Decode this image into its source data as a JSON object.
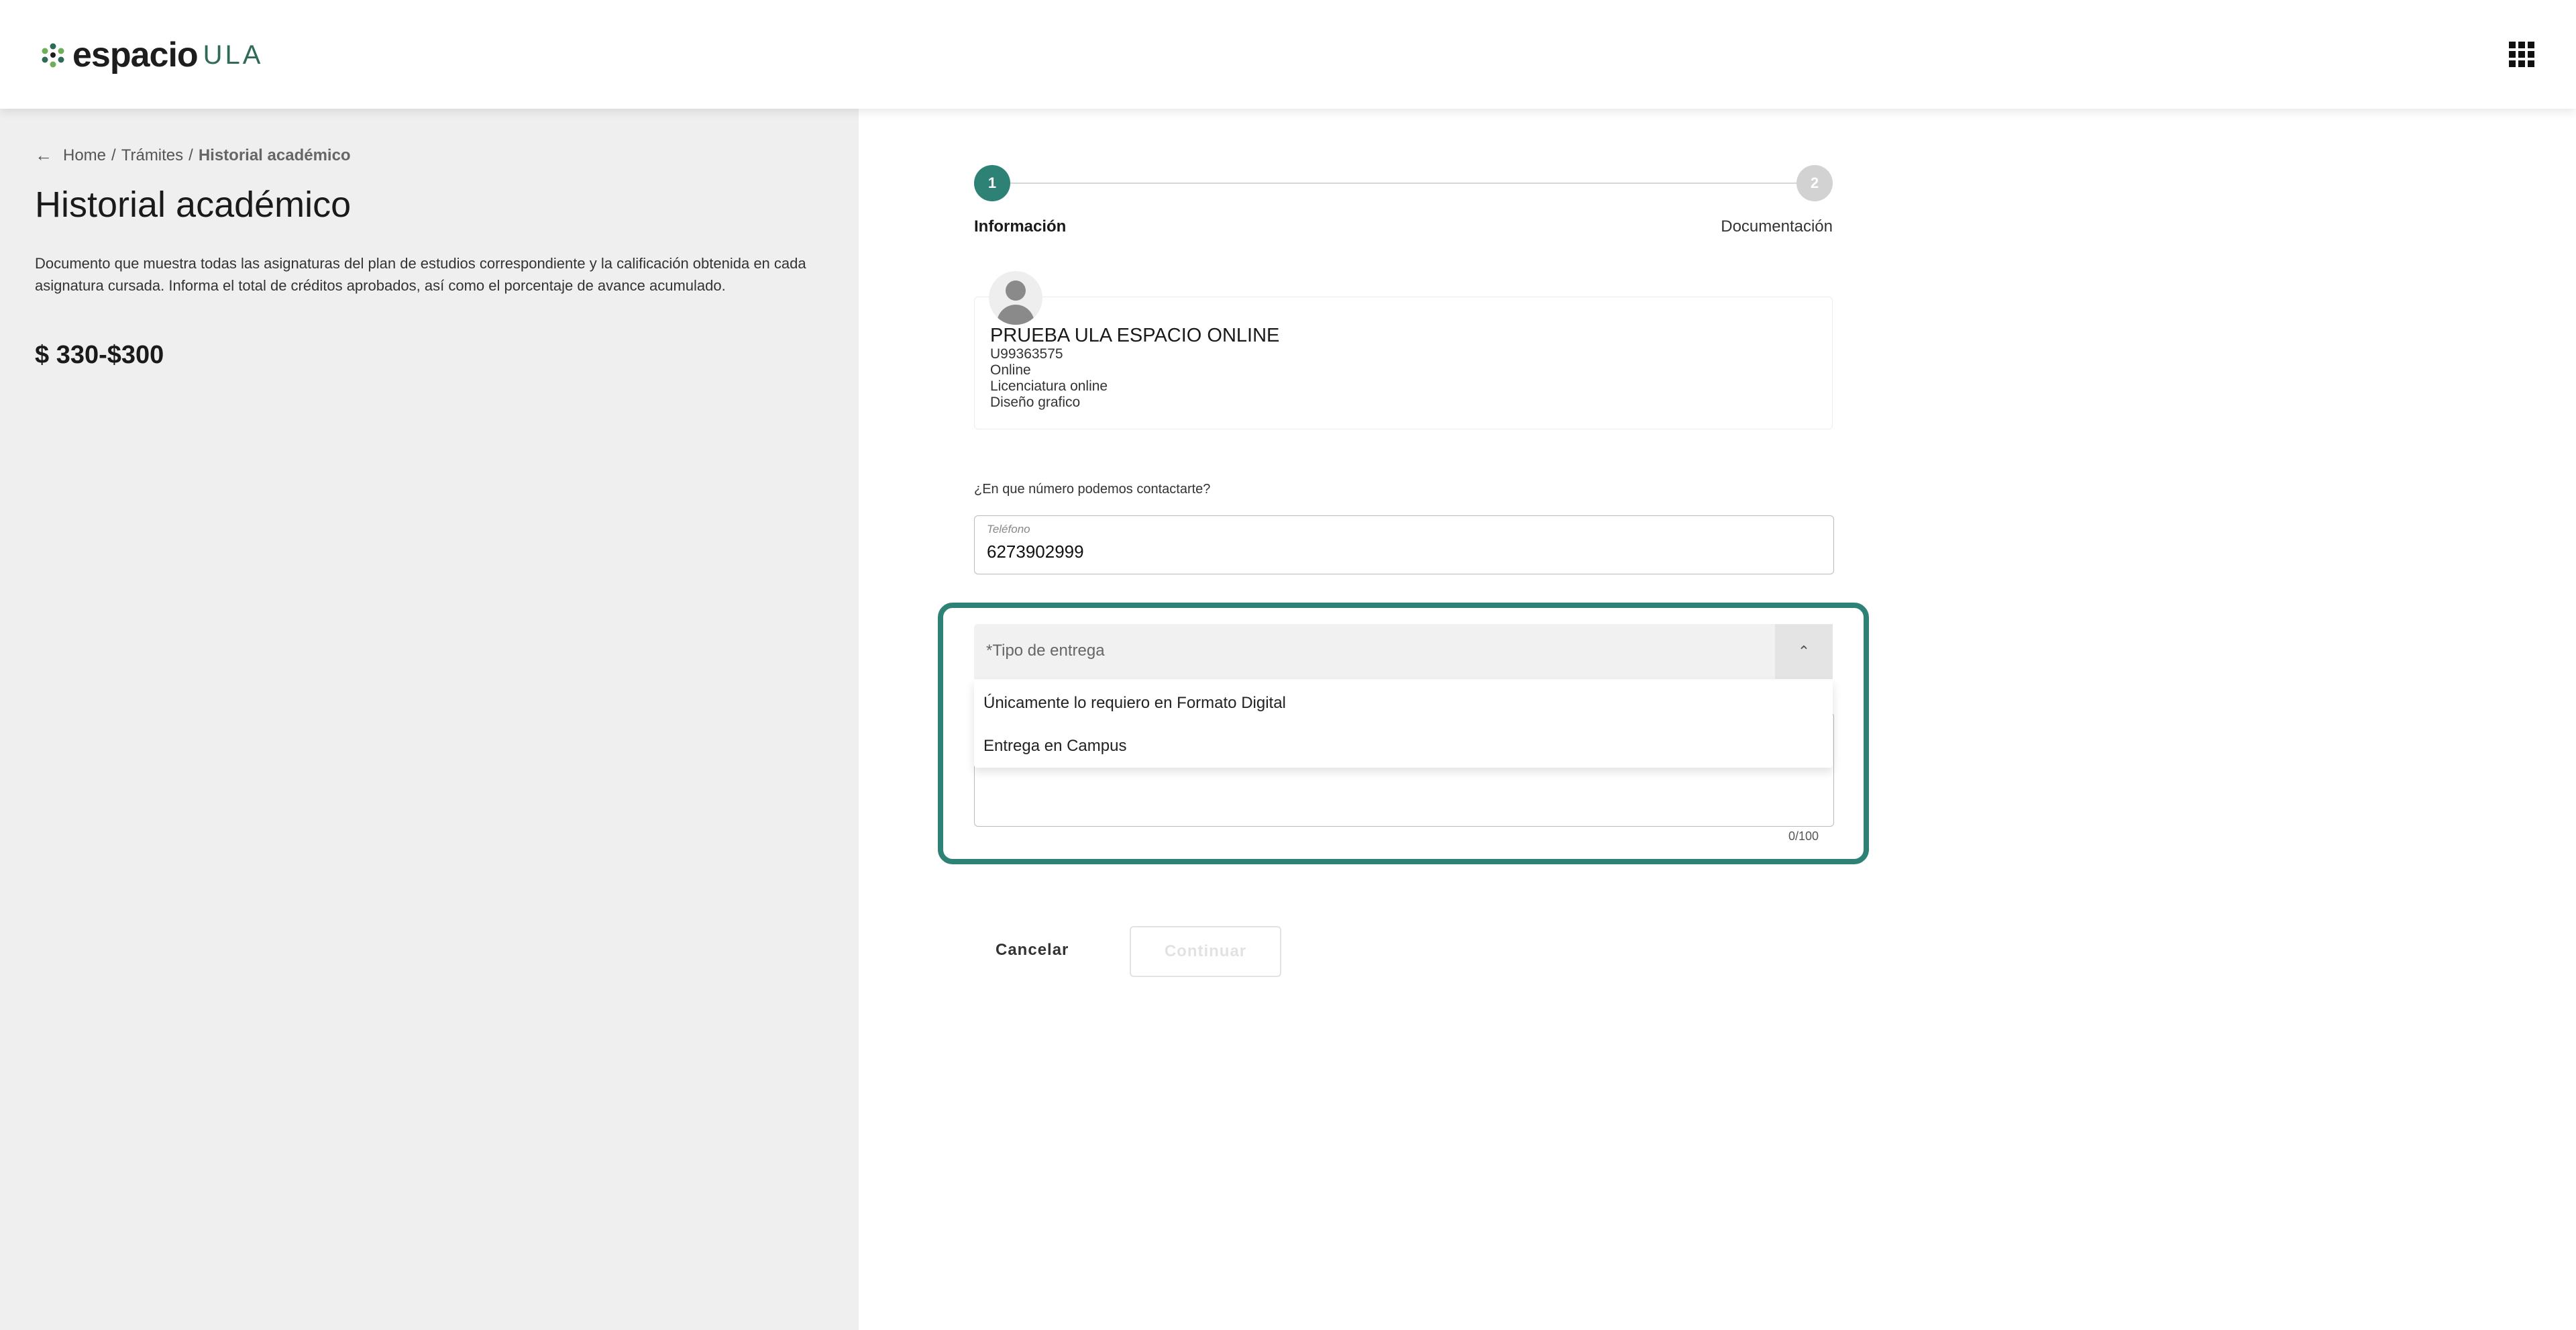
{
  "header": {
    "logo_word": "espacio",
    "logo_suffix": "ULA"
  },
  "sidebar": {
    "breadcrumb": {
      "home": "Home",
      "sep1": "/",
      "tramites": "Trámites",
      "sep2": "/",
      "current": "Historial académico"
    },
    "title": "Historial académico",
    "description": "Documento que muestra todas las asignaturas del plan de estudios correspondiente y la calificación obtenida en cada asignatura cursada. Informa el total de créditos aprobados, así como el porcentaje de avance acumulado.",
    "price": "$ 330-$300"
  },
  "stepper": {
    "step1_number": "1",
    "step1_label": "Información",
    "step2_number": "2",
    "step2_label": "Documentación"
  },
  "profile": {
    "name": "PRUEBA ULA ESPACIO ONLINE",
    "id": "U99363575",
    "modality": "Online",
    "level": "Licenciatura online",
    "program": "Diseño grafico"
  },
  "contact": {
    "question": "¿En que número podemos contactarte?",
    "phone_label": "Teléfono",
    "phone_value": "6273902999"
  },
  "delivery": {
    "select_label": "*Tipo de entrega",
    "options": [
      "Únicamente lo requiero en Formato Digital",
      "Entrega en Campus"
    ],
    "counter": "0/100"
  },
  "actions": {
    "cancel": "Cancelar",
    "continue": "Continuar"
  },
  "colors": {
    "accent": "#2d8275",
    "left_panel_bg": "#efefef"
  }
}
